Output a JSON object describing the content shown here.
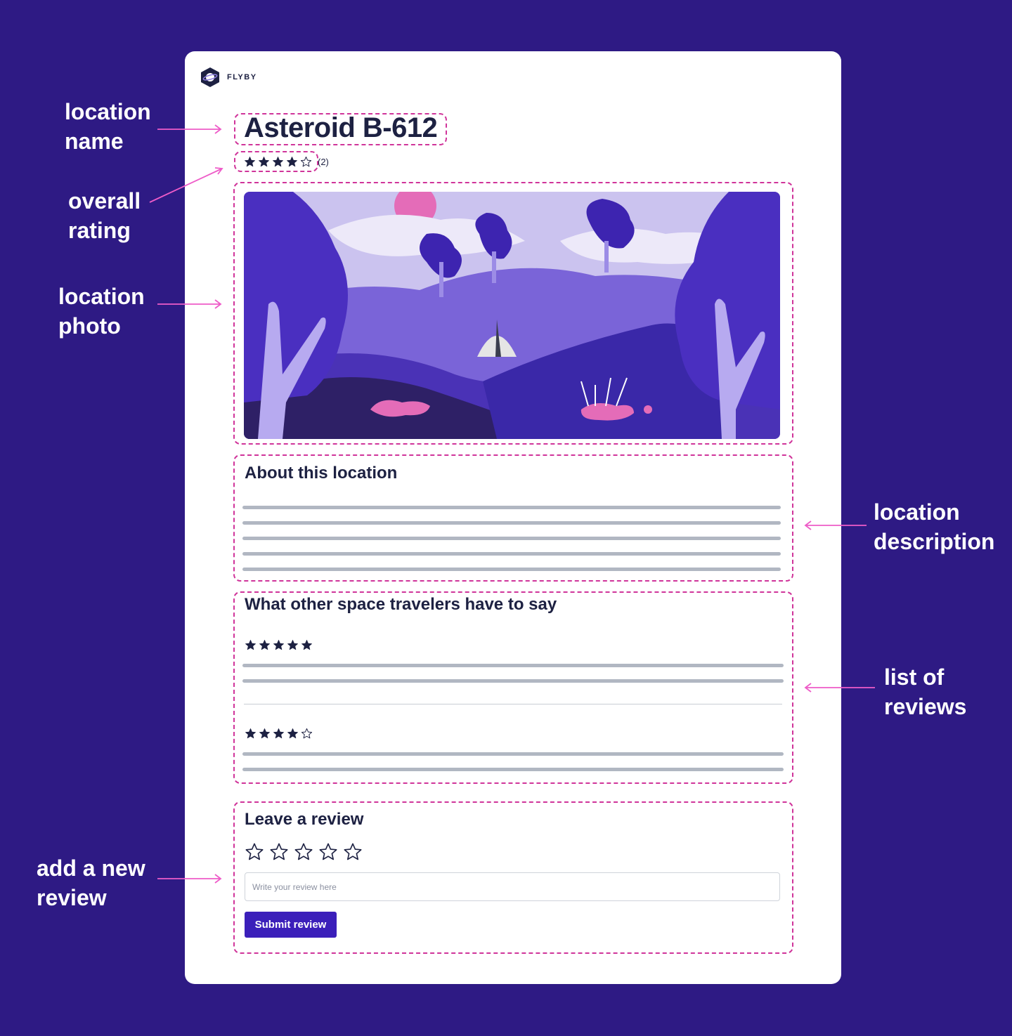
{
  "brand": {
    "name": "FLYBY",
    "logo_icon": "planet-hexagon-icon"
  },
  "location": {
    "name": "Asteroid B-612",
    "rating": 4,
    "max_rating": 5,
    "review_count": "(2)",
    "photo_alt": "Illustrated purple alien landscape with trees, hills, a dome tent and a pink sun"
  },
  "about": {
    "heading": "About this location",
    "placeholder_lines": 5
  },
  "reviews": {
    "heading": "What other space travelers have to say",
    "items": [
      {
        "rating": 5,
        "placeholder_lines": 2
      },
      {
        "rating": 4,
        "placeholder_lines": 2
      }
    ]
  },
  "new_review": {
    "heading": "Leave a review",
    "rating": 0,
    "input_placeholder": "Write your review here",
    "input_value": "",
    "submit_label": "Submit review"
  },
  "annotations": {
    "location_name": [
      "location",
      "name"
    ],
    "overall_rating": [
      "overall",
      "rating"
    ],
    "location_photo": [
      "location",
      "photo"
    ],
    "location_description": [
      "location",
      "description"
    ],
    "list_of_reviews": [
      "list of",
      "reviews"
    ],
    "add_review": [
      "add a new",
      "review"
    ]
  },
  "colors": {
    "background": "#2e1a84",
    "card": "#ffffff",
    "annotation": "#d0349a",
    "text": "#1d2142",
    "accent": "#3b1fba",
    "placeholder_line": "#b1b7c2"
  }
}
